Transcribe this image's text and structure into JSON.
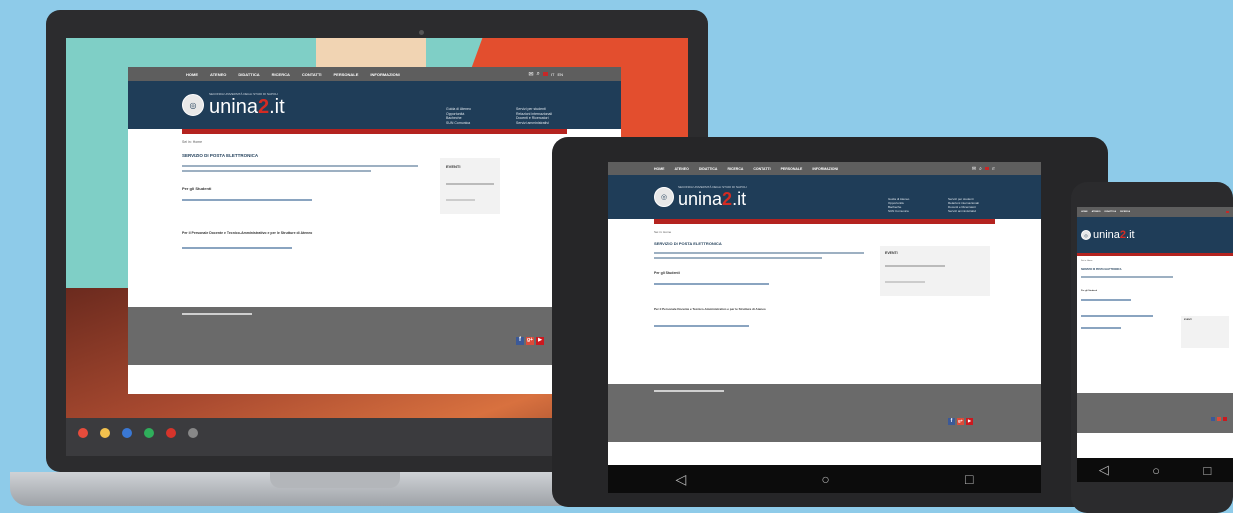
{
  "site": {
    "nav_items": [
      "HOME",
      "ATENEO",
      "DIDATTICA",
      "RICERCA",
      "CONTATTI",
      "PERSONALE",
      "INFORMAZIONI"
    ],
    "lang_labels": [
      "IT",
      "EN"
    ],
    "university_name": "SECONDA UNIVERSITÀ DEGLI STUDI DI NAPOLI",
    "brand_prefix": "unina",
    "brand_digit": "2",
    "brand_suffix": ".it",
    "header_links_left": [
      "Guida di Ateneo",
      "Opportunità",
      "Bacheche",
      "SUN Comunica"
    ],
    "header_links_right": [
      "Servizi per studenti",
      "Relazioni internazionali",
      "Docenti e Ricercatori",
      "Servizi amministrativi"
    ],
    "breadcrumb": "Sei in: Home",
    "page_title": "SERVIZIO DI POSTA ELETTRONICA",
    "events_title": "EVENTI",
    "students_heading": "Per gli Studenti",
    "staff_heading": "Per il Personale Docente e Tecnico-Amministrativo e per le Strutture di Ateneo",
    "social": [
      "f",
      "g+",
      "▶"
    ]
  },
  "devices": {
    "tablet_nav": [
      "◁",
      "○",
      "□"
    ],
    "phone_nav": [
      "◁",
      "○",
      "□"
    ]
  },
  "colors": {
    "nav_bg": "#5e5e5e",
    "header_bg": "#1f3d58",
    "accent_red": "#b4231f",
    "footer_bg": "#6a6a6a"
  }
}
